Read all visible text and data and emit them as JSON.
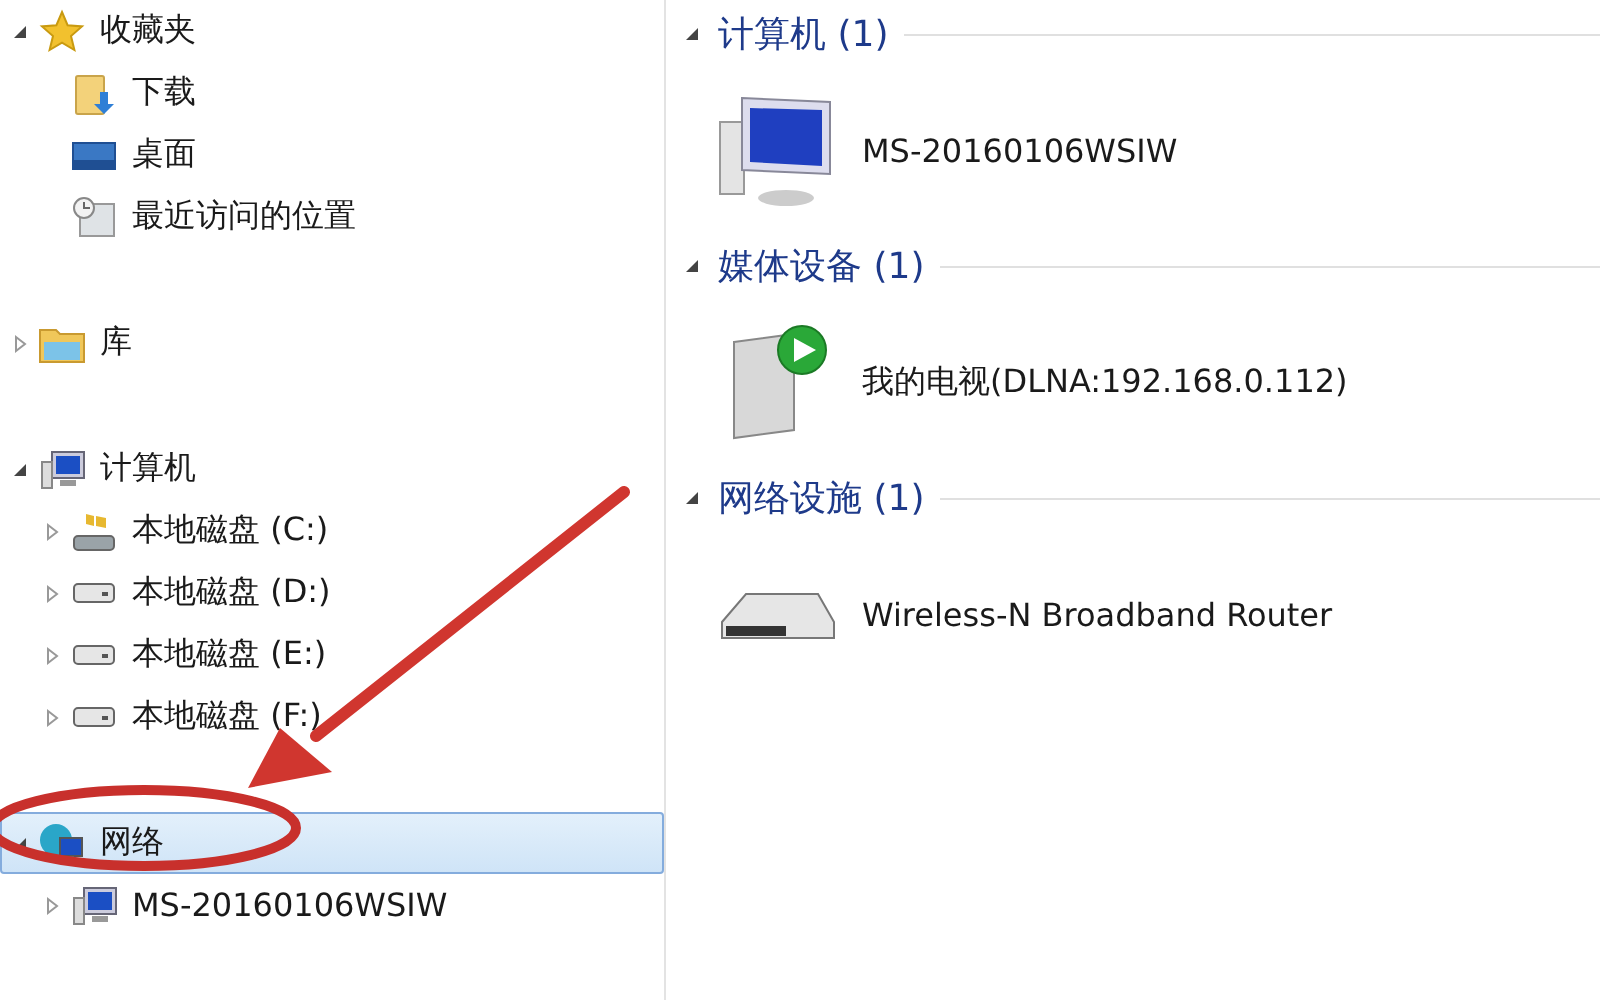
{
  "navigation_tree": [
    {
      "label": "收藏夹",
      "kind": "favorites",
      "expanded": true,
      "selected": false,
      "children": [
        {
          "label": "下载",
          "kind": "downloads",
          "selected": false
        },
        {
          "label": "桌面",
          "kind": "desktop",
          "selected": false
        },
        {
          "label": "最近访问的位置",
          "kind": "recent",
          "selected": false
        }
      ]
    },
    {
      "label": "库",
      "kind": "library",
      "expanded": false,
      "selected": false
    },
    {
      "label": "计算机",
      "kind": "computer",
      "expanded": true,
      "selected": false,
      "children": [
        {
          "label": "本地磁盘 (C:)",
          "kind": "system-drive",
          "expanded": false,
          "selected": false
        },
        {
          "label": "本地磁盘 (D:)",
          "kind": "drive",
          "expanded": false,
          "selected": false
        },
        {
          "label": "本地磁盘 (E:)",
          "kind": "drive",
          "expanded": false,
          "selected": false
        },
        {
          "label": "本地磁盘 (F:)",
          "kind": "drive",
          "expanded": false,
          "selected": false
        }
      ]
    },
    {
      "label": "网络",
      "kind": "network",
      "expanded": true,
      "selected": true,
      "children": [
        {
          "label": "MS-20160106WSIW",
          "kind": "pc",
          "expanded": false,
          "selected": false
        }
      ]
    }
  ],
  "content_groups": [
    {
      "title": "计算机 (1)",
      "expanded": true,
      "items": [
        {
          "name": "MS-20160106WSIW",
          "kind": "monitor"
        }
      ]
    },
    {
      "title": "媒体设备 (1)",
      "expanded": true,
      "items": [
        {
          "name": "我的电视(DLNA:192.168.0.112)",
          "kind": "media"
        }
      ]
    },
    {
      "title": "网络设施 (1)",
      "expanded": true,
      "items": [
        {
          "name": "Wireless-N Broadband Router",
          "kind": "router"
        }
      ]
    }
  ]
}
